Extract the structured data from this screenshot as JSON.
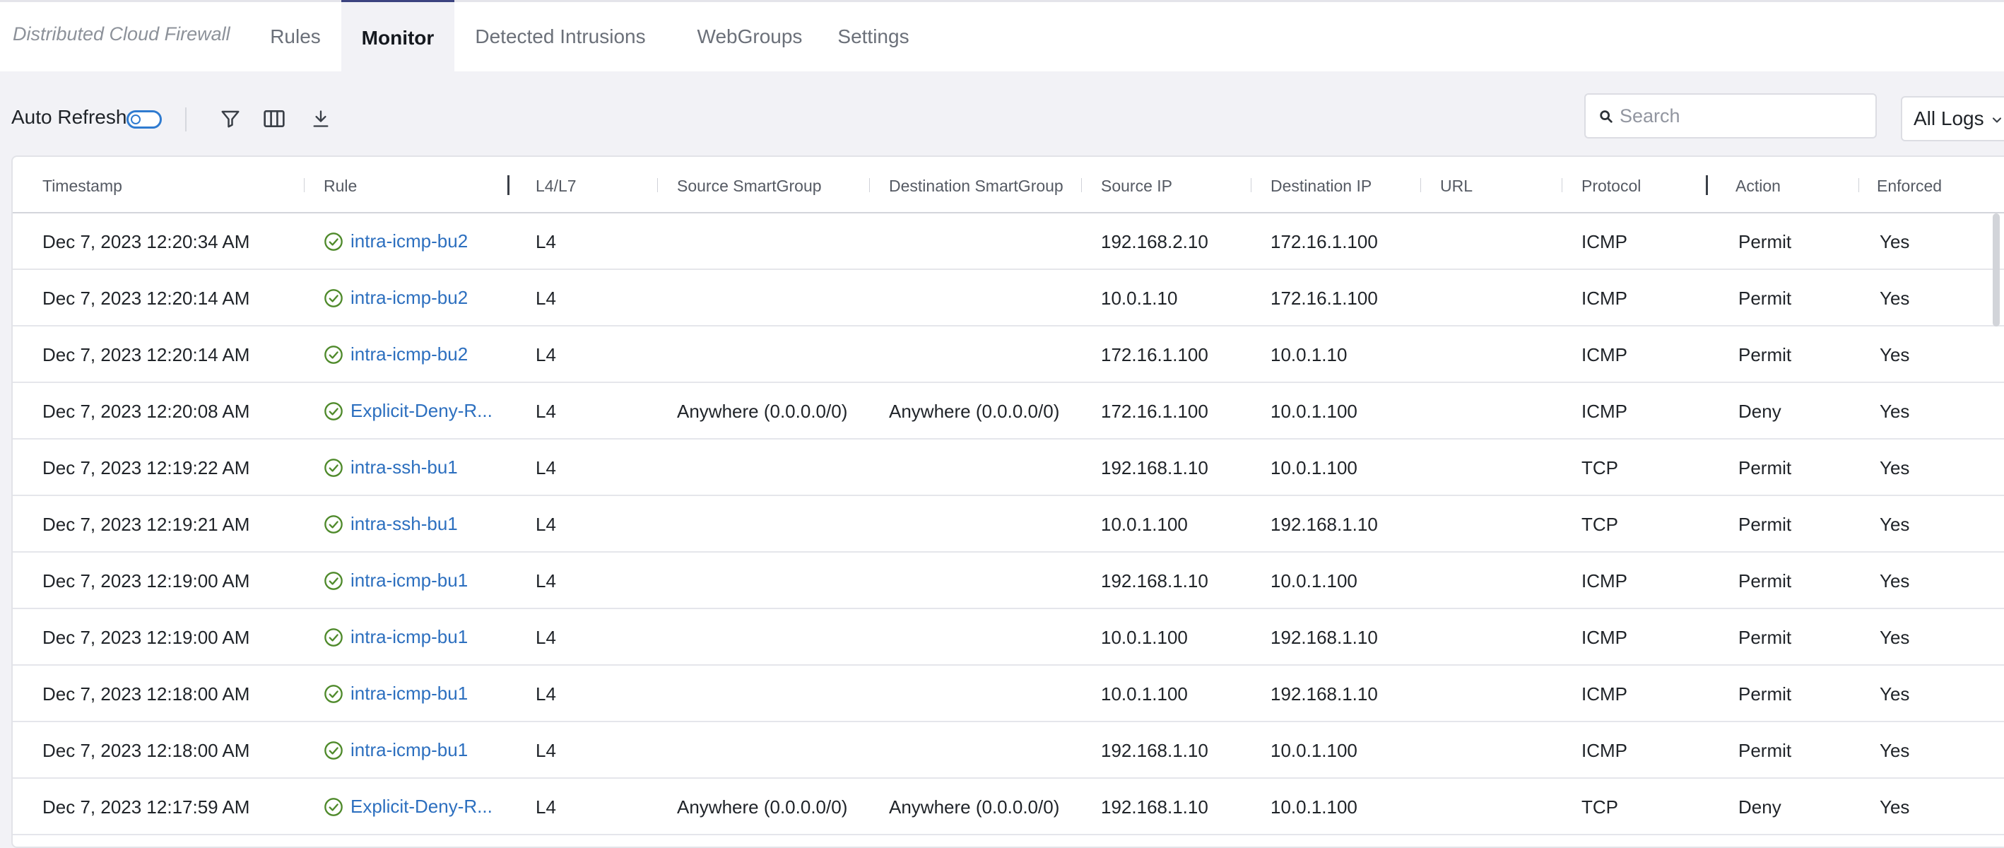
{
  "app": {
    "title": "Distributed Cloud Firewall"
  },
  "tabs": [
    {
      "label": "Rules",
      "active": false
    },
    {
      "label": "Monitor",
      "active": true
    },
    {
      "label": "Detected Intrusions",
      "active": false
    },
    {
      "label": "WebGroups",
      "active": false
    },
    {
      "label": "Settings",
      "active": false
    }
  ],
  "toolbar": {
    "auto_refresh_label": "Auto Refresh",
    "auto_refresh_on": false,
    "icons": [
      "filter-icon",
      "columns-icon",
      "download-icon"
    ],
    "search_placeholder": "Search",
    "search_value": "",
    "logs_select": "All Logs"
  },
  "table": {
    "columns": [
      "Timestamp",
      "Rule",
      "L4/L7",
      "Source SmartGroup",
      "Destination SmartGroup",
      "Source IP",
      "Destination IP",
      "URL",
      "Protocol",
      "Action",
      "Enforced"
    ],
    "rows": [
      {
        "timestamp": "Dec 7, 2023 12:20:34 AM",
        "rule": "intra-icmp-bu2",
        "l4l7": "L4",
        "src_sg": "",
        "dst_sg": "",
        "src_ip": "192.168.2.10",
        "dst_ip": "172.16.1.100",
        "url": "",
        "protocol": "ICMP",
        "action": "Permit",
        "enforced": "Yes"
      },
      {
        "timestamp": "Dec 7, 2023 12:20:14 AM",
        "rule": "intra-icmp-bu2",
        "l4l7": "L4",
        "src_sg": "",
        "dst_sg": "",
        "src_ip": "10.0.1.10",
        "dst_ip": "172.16.1.100",
        "url": "",
        "protocol": "ICMP",
        "action": "Permit",
        "enforced": "Yes"
      },
      {
        "timestamp": "Dec 7, 2023 12:20:14 AM",
        "rule": "intra-icmp-bu2",
        "l4l7": "L4",
        "src_sg": "",
        "dst_sg": "",
        "src_ip": "172.16.1.100",
        "dst_ip": "10.0.1.10",
        "url": "",
        "protocol": "ICMP",
        "action": "Permit",
        "enforced": "Yes"
      },
      {
        "timestamp": "Dec 7, 2023 12:20:08 AM",
        "rule": "Explicit-Deny-R...",
        "l4l7": "L4",
        "src_sg": "Anywhere (0.0.0.0/0)",
        "dst_sg": "Anywhere (0.0.0.0/0)",
        "src_ip": "172.16.1.100",
        "dst_ip": "10.0.1.100",
        "url": "",
        "protocol": "ICMP",
        "action": "Deny",
        "enforced": "Yes"
      },
      {
        "timestamp": "Dec 7, 2023 12:19:22 AM",
        "rule": "intra-ssh-bu1",
        "l4l7": "L4",
        "src_sg": "",
        "dst_sg": "",
        "src_ip": "192.168.1.10",
        "dst_ip": "10.0.1.100",
        "url": "",
        "protocol": "TCP",
        "action": "Permit",
        "enforced": "Yes"
      },
      {
        "timestamp": "Dec 7, 2023 12:19:21 AM",
        "rule": "intra-ssh-bu1",
        "l4l7": "L4",
        "src_sg": "",
        "dst_sg": "",
        "src_ip": "10.0.1.100",
        "dst_ip": "192.168.1.10",
        "url": "",
        "protocol": "TCP",
        "action": "Permit",
        "enforced": "Yes"
      },
      {
        "timestamp": "Dec 7, 2023 12:19:00 AM",
        "rule": "intra-icmp-bu1",
        "l4l7": "L4",
        "src_sg": "",
        "dst_sg": "",
        "src_ip": "192.168.1.10",
        "dst_ip": "10.0.1.100",
        "url": "",
        "protocol": "ICMP",
        "action": "Permit",
        "enforced": "Yes"
      },
      {
        "timestamp": "Dec 7, 2023 12:19:00 AM",
        "rule": "intra-icmp-bu1",
        "l4l7": "L4",
        "src_sg": "",
        "dst_sg": "",
        "src_ip": "10.0.1.100",
        "dst_ip": "192.168.1.10",
        "url": "",
        "protocol": "ICMP",
        "action": "Permit",
        "enforced": "Yes"
      },
      {
        "timestamp": "Dec 7, 2023 12:18:00 AM",
        "rule": "intra-icmp-bu1",
        "l4l7": "L4",
        "src_sg": "",
        "dst_sg": "",
        "src_ip": "10.0.1.100",
        "dst_ip": "192.168.1.10",
        "url": "",
        "protocol": "ICMP",
        "action": "Permit",
        "enforced": "Yes"
      },
      {
        "timestamp": "Dec 7, 2023 12:18:00 AM",
        "rule": "intra-icmp-bu1",
        "l4l7": "L4",
        "src_sg": "",
        "dst_sg": "",
        "src_ip": "192.168.1.10",
        "dst_ip": "10.0.1.100",
        "url": "",
        "protocol": "ICMP",
        "action": "Permit",
        "enforced": "Yes"
      },
      {
        "timestamp": "Dec 7, 2023 12:17:59 AM",
        "rule": "Explicit-Deny-R...",
        "l4l7": "L4",
        "src_sg": "Anywhere (0.0.0.0/0)",
        "dst_sg": "Anywhere (0.0.0.0/0)",
        "src_ip": "192.168.1.10",
        "dst_ip": "10.0.1.100",
        "url": "",
        "protocol": "TCP",
        "action": "Deny",
        "enforced": "Yes"
      }
    ]
  },
  "colors": {
    "accent": "#2f7bd0",
    "link": "#2c6fbf",
    "success": "#4f8a2b",
    "active_tab_border": "#3c4380"
  }
}
